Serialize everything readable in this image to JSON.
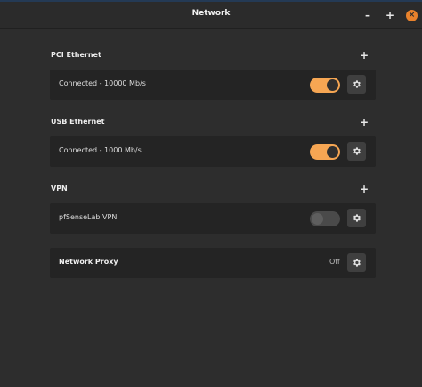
{
  "window": {
    "title": "Network",
    "minimize_label": "–",
    "maximize_label": "+",
    "close_label": "×"
  },
  "sections": {
    "pci": {
      "title": "PCI Ethernet",
      "add_label": "+",
      "status": "Connected - 10000 Mb/s",
      "enabled": true
    },
    "usb": {
      "title": "USB Ethernet",
      "add_label": "+",
      "status": "Connected - 1000 Mb/s",
      "enabled": true
    },
    "vpn": {
      "title": "VPN",
      "add_label": "+",
      "name": "pfSenseLab VPN",
      "enabled": false
    },
    "proxy": {
      "label": "Network Proxy",
      "status": "Off"
    }
  },
  "colors": {
    "accent": "#f6a653",
    "close_button": "#e8822c",
    "background": "#2d2d2d",
    "row_background": "#242424"
  },
  "icons": {
    "settings": "gear-icon",
    "add": "plus-icon",
    "close": "close-icon"
  }
}
